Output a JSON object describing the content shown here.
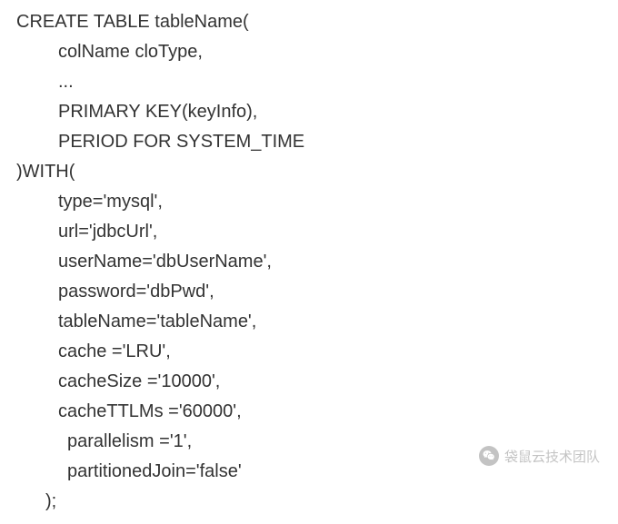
{
  "code": {
    "line1": "CREATE TABLE tableName(",
    "line2": "colName cloType,",
    "line3": "...",
    "line4": "PRIMARY KEY(keyInfo),",
    "line5": "PERIOD FOR SYSTEM_TIME",
    "line6": ")WITH(",
    "line7": "type='mysql',",
    "line8": "url='jdbcUrl',",
    "line9": "userName='dbUserName',",
    "line10": "password='dbPwd',",
    "line11": "tableName='tableName',",
    "line12": "cache ='LRU',",
    "line13": "cacheSize ='10000',",
    "line14": "cacheTTLMs ='60000',",
    "line15": "parallelism ='1',",
    "line16": "partitionedJoin='false'",
    "line17": ");"
  },
  "watermark": {
    "text": "袋鼠云技术团队"
  }
}
